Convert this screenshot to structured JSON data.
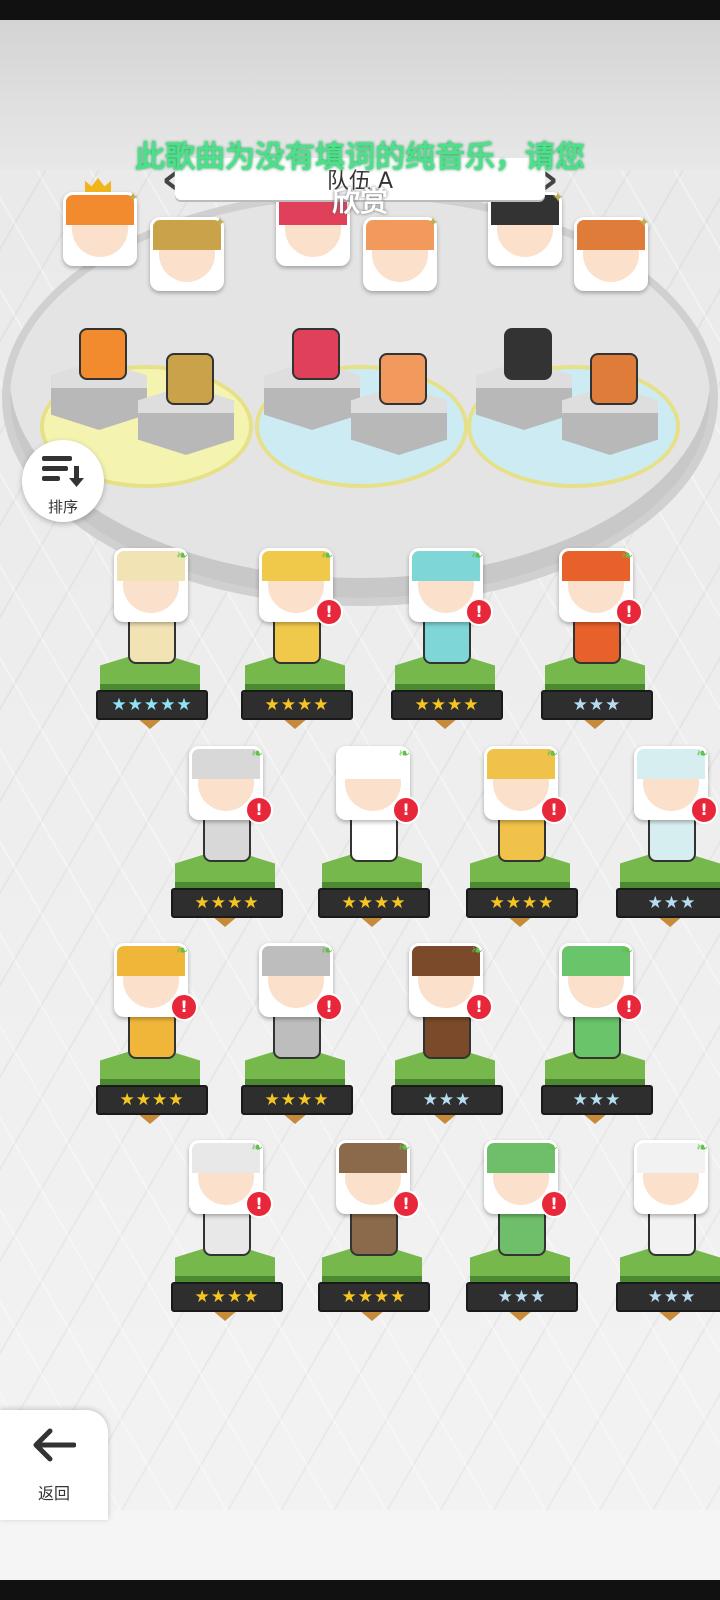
{
  "lyric": "此歌曲为没有填词的纯音乐，请您",
  "lyric_second": "欣赏",
  "team_label": "队伍 A",
  "sort_label": "排序",
  "back_label": "返回",
  "colors": {
    "lyric": "#4ce08a",
    "alert": "#e8283a",
    "grass": "#76b84c",
    "gold_star": "#f5c623",
    "silver_star": "#b8dcef"
  },
  "stars": {
    "five": "★★★★★",
    "four": "★★★★",
    "three": "★★★"
  },
  "team_members": [
    {
      "crown": true,
      "icon": "sparkle-icon",
      "hair": "#f28a2e"
    },
    {
      "crown": false,
      "icon": "sparkle-icon",
      "hair": "#c9a24a"
    },
    {
      "crown": true,
      "icon": "sparkle-icon",
      "hair": "#e0405a"
    },
    {
      "crown": false,
      "icon": "sparkle-icon",
      "hair": "#f29a5e"
    },
    {
      "crown": true,
      "icon": "sparkle-icon",
      "hair": "#333333"
    },
    {
      "crown": false,
      "icon": "sparkle-icon",
      "hair": "#e07c3a"
    }
  ],
  "roster": [
    {
      "stars": "★★★★★",
      "tier": "rainbow",
      "alert": false,
      "hair": "#f2e3b5"
    },
    {
      "stars": "★★★★",
      "tier": "gold",
      "alert": true,
      "hair": "#f1c94a"
    },
    {
      "stars": "★★★★",
      "tier": "gold",
      "alert": true,
      "hair": "#7fd6d6"
    },
    {
      "stars": "★★★",
      "tier": "silver",
      "alert": true,
      "hair": "#e8602a"
    },
    {
      "stars": "★★★★",
      "tier": "gold",
      "alert": true,
      "hair": "#d8d8d8"
    },
    {
      "stars": "★★★★",
      "tier": "gold",
      "alert": true,
      "hair": "#ffffff"
    },
    {
      "stars": "★★★★",
      "tier": "gold",
      "alert": true,
      "hair": "#f0c24a"
    },
    {
      "stars": "★★★",
      "tier": "silver",
      "alert": true,
      "hair": "#d7eef0"
    },
    {
      "stars": "★★★★",
      "tier": "gold",
      "alert": true,
      "hair": "#f0b63a"
    },
    {
      "stars": "★★★★",
      "tier": "gold",
      "alert": true,
      "hair": "#bdbdbd"
    },
    {
      "stars": "★★★",
      "tier": "silver",
      "alert": true,
      "hair": "#7a4a2a"
    },
    {
      "stars": "★★★",
      "tier": "silver",
      "alert": true,
      "hair": "#69c46a"
    },
    {
      "stars": "★★★★",
      "tier": "gold",
      "alert": true,
      "hair": "#e8e8e8"
    },
    {
      "stars": "★★★★",
      "tier": "gold",
      "alert": true,
      "hair": "#8a6a4a"
    },
    {
      "stars": "★★★",
      "tier": "silver",
      "alert": true,
      "hair": "#6fbf6a"
    },
    {
      "stars": "★★★",
      "tier": "silver",
      "alert": false,
      "hair": "#f2f2f2"
    }
  ]
}
